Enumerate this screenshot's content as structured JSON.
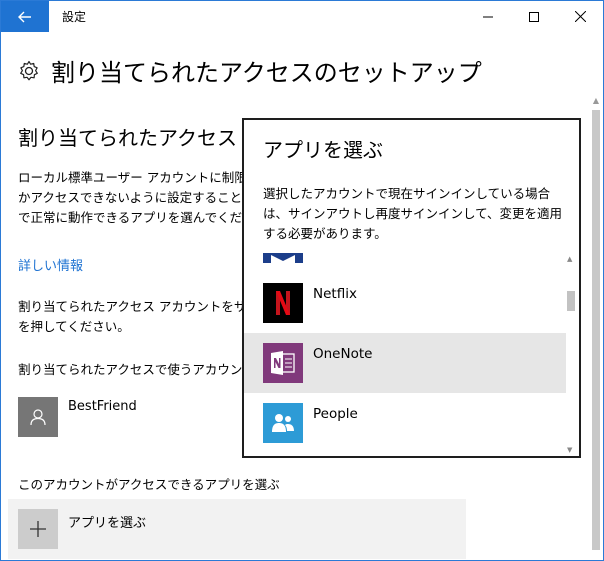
{
  "window": {
    "title": "設定"
  },
  "page": {
    "title": "割り当てられたアクセスのセットアップ",
    "section_title": "割り当てられたアクセス",
    "description_lines": [
      "ローカル標準ユーザー アカウントに制限を",
      "かアクセスできないように設定することが",
      "で正常に動作できるアプリを選んでくだ"
    ],
    "link": "詳しい情報",
    "instruction_lines": [
      "割り当てられたアクセス アカウントをサイ",
      "を押してください。"
    ],
    "account_label": "割り当てられたアクセスで使うアカウント",
    "account_name": "BestFriend",
    "choose_app_label": "このアカウントがアクセスできるアプリを選ぶ",
    "add_app_button": "アプリを選ぶ"
  },
  "flyout": {
    "title": "アプリを選ぶ",
    "description": "選択したアカウントで現在サインインしている場合は、サインアウトし再度サインインして、変更を適用する必要があります。",
    "apps": [
      {
        "name": "",
        "icon": "partial-app-icon",
        "color": "#1c3e8a"
      },
      {
        "name": "Netflix",
        "icon": "netflix-icon",
        "color": "#000000"
      },
      {
        "name": "OneNote",
        "icon": "onenote-icon",
        "color": "#80397b",
        "selected": true
      },
      {
        "name": "People",
        "icon": "people-icon",
        "color": "#2d9bd6"
      }
    ]
  },
  "colors": {
    "accent": "#1f73d2",
    "selected_bg": "#e6e6e6"
  }
}
